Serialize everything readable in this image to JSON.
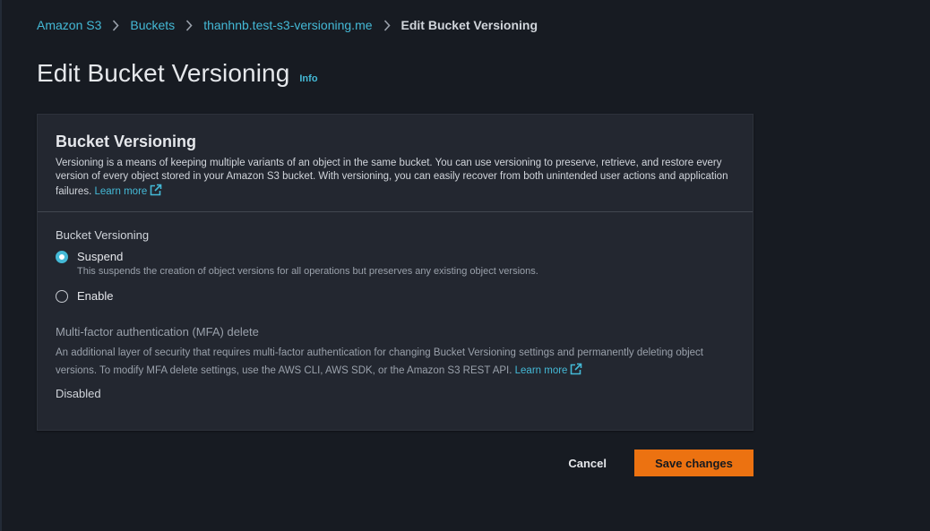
{
  "breadcrumb": {
    "items": [
      "Amazon S3",
      "Buckets",
      "thanhnb.test-s3-versioning.me"
    ],
    "current": "Edit Bucket Versioning"
  },
  "page": {
    "title": "Edit Bucket Versioning",
    "info_label": "Info"
  },
  "panel": {
    "title": "Bucket Versioning",
    "description": "Versioning is a means of keeping multiple variants of an object in the same bucket. You can use versioning to preserve, retrieve, and restore every version of every object stored in your Amazon S3 bucket. With versioning, you can easily recover from both unintended user actions and application failures.",
    "learn_more": "Learn more"
  },
  "versioning": {
    "label": "Bucket Versioning",
    "options": [
      {
        "label": "Suspend",
        "description": "This suspends the creation of object versions for all operations but preserves any existing object versions.",
        "selected": true
      },
      {
        "label": "Enable",
        "selected": false
      }
    ]
  },
  "mfa": {
    "title": "Multi-factor authentication (MFA) delete",
    "description": "An additional layer of security that requires multi-factor authentication for changing Bucket Versioning settings and permanently deleting object versions. To modify MFA delete settings, use the AWS CLI, AWS SDK, or the Amazon S3 REST API.",
    "learn_more": "Learn more",
    "value": "Disabled"
  },
  "actions": {
    "cancel_label": "Cancel",
    "save_label": "Save changes"
  },
  "colors": {
    "link": "#44b9d6",
    "primary_button": "#ec7211",
    "background": "#171b22",
    "panel": "#232730"
  }
}
